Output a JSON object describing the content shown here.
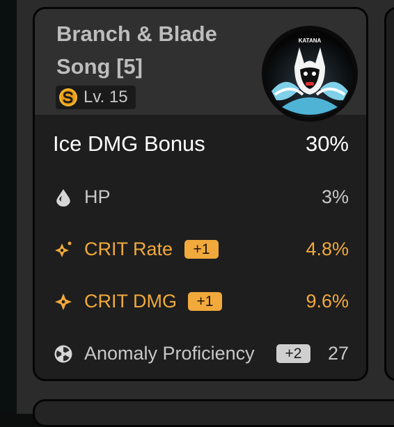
{
  "disc": {
    "title": "Branch & Blade Song [5]",
    "level_label": "Lv. 15",
    "rank_icon": "s-rank-icon",
    "art_caption": "KATANA",
    "accent_color": "#f2a93b"
  },
  "main_stat": {
    "name": "Ice DMG Bonus",
    "value": "30%"
  },
  "sub_stats": [
    {
      "name": "HP",
      "value": "3%",
      "icon": "hp-drop-icon",
      "badge": ""
    },
    {
      "name": "CRIT Rate",
      "value": "4.8%",
      "icon": "crit-rate-icon",
      "badge": "+1"
    },
    {
      "name": "CRIT DMG",
      "value": "9.6%",
      "icon": "crit-dmg-icon",
      "badge": "+1"
    },
    {
      "name": "Anomaly Proficiency",
      "value": "27",
      "icon": "anomaly-proficiency-icon",
      "badge": "+2"
    }
  ]
}
